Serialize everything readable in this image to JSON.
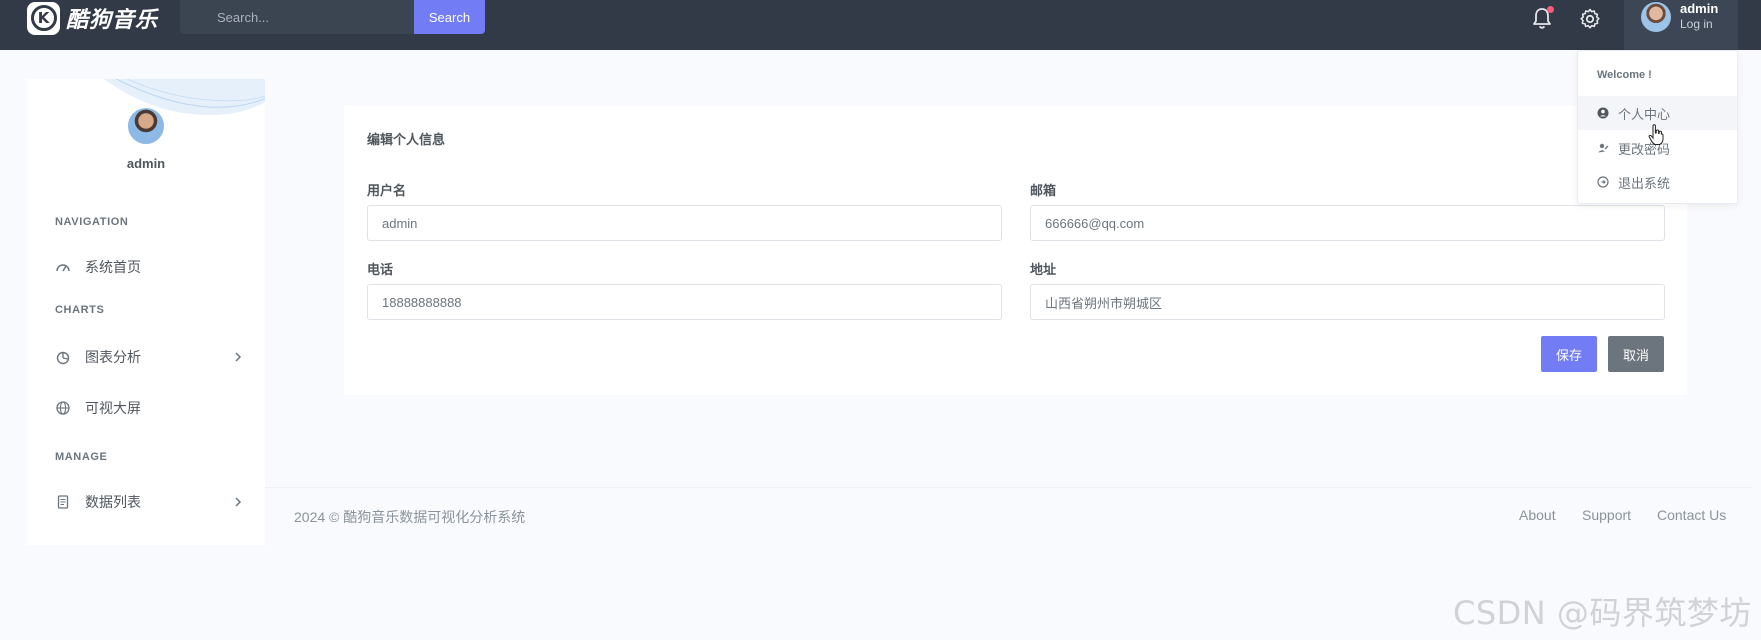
{
  "brand": {
    "logo_letter": "K",
    "name": "酷狗音乐"
  },
  "topbar": {
    "search_placeholder": "Search...",
    "search_button": "Search",
    "user_name": "admin",
    "user_subtitle": "Log in"
  },
  "dropdown": {
    "welcome": "Welcome !",
    "items": [
      {
        "label": "个人中心",
        "icon": "user-circle-icon"
      },
      {
        "label": "更改密码",
        "icon": "user-edit-icon"
      },
      {
        "label": "退出系统",
        "icon": "logout-icon"
      }
    ]
  },
  "sidebar": {
    "user_name": "admin",
    "sections": [
      {
        "title": "NAVIGATION",
        "items": [
          {
            "label": "系统首页",
            "icon": "speedometer-icon"
          }
        ]
      },
      {
        "title": "CHARTS",
        "items": [
          {
            "label": "图表分析",
            "icon": "pie-chart-icon",
            "has_submenu": true
          },
          {
            "label": "可视大屏",
            "icon": "globe-icon"
          }
        ]
      },
      {
        "title": "MANAGE",
        "items": [
          {
            "label": "数据列表",
            "icon": "document-icon",
            "has_submenu": true
          }
        ]
      }
    ]
  },
  "form": {
    "title": "编辑个人信息",
    "fields": {
      "username": {
        "label": "用户名",
        "value": "admin"
      },
      "email": {
        "label": "邮箱",
        "value": "666666@qq.com"
      },
      "phone": {
        "label": "电话",
        "value": "18888888888"
      },
      "address": {
        "label": "地址",
        "value": "山西省朔州市朔城区"
      }
    },
    "save": "保存",
    "cancel": "取消"
  },
  "footer": {
    "copyright": "2024 © 酷狗音乐数据可视化分析系统",
    "links": [
      "About",
      "Support",
      "Contact Us"
    ]
  },
  "watermark": "CSDN @码界筑梦坊",
  "colors": {
    "topbar": "#313a46",
    "primary": "#727cf5",
    "secondary": "#6c757d",
    "notification": "#fa5c7c"
  }
}
